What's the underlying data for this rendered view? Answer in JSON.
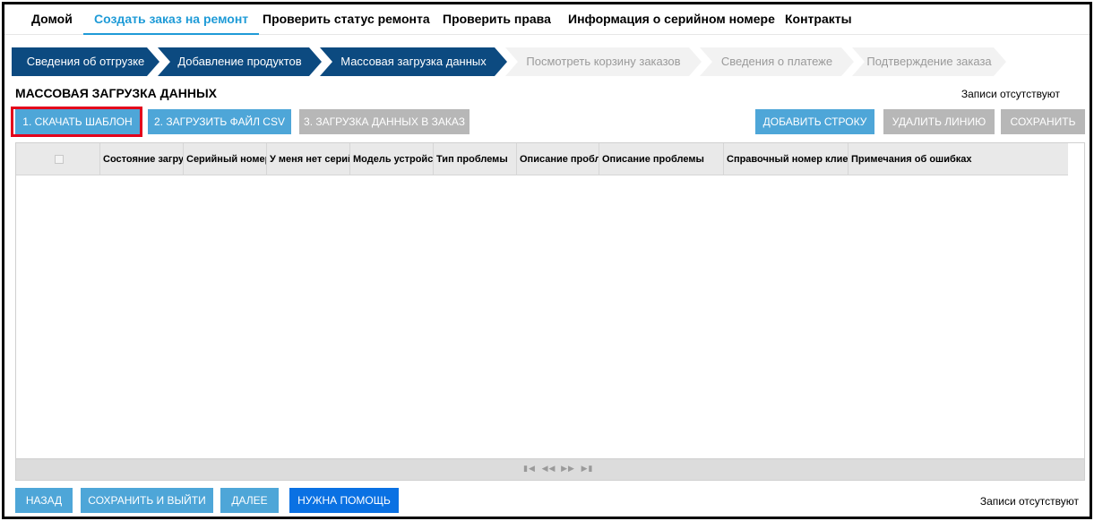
{
  "topnav": {
    "items": [
      {
        "label": "Домой",
        "active": false
      },
      {
        "label": "Создать заказ на ремонт",
        "active": true
      },
      {
        "label": "Проверить статус ремонта",
        "active": false
      },
      {
        "label": "Проверить права",
        "active": false
      },
      {
        "label": "Информация о серийном номере",
        "active": false
      },
      {
        "label": "Контракты",
        "active": false
      }
    ]
  },
  "steps": [
    {
      "label": "Сведения об отгрузке",
      "state": "done"
    },
    {
      "label": "Добавление продуктов",
      "state": "done"
    },
    {
      "label": "Массовая загрузка данных",
      "state": "done"
    },
    {
      "label": "Посмотреть корзину заказов",
      "state": "todo"
    },
    {
      "label": "Сведения о платеже",
      "state": "todo"
    },
    {
      "label": "Подтверждение заказа",
      "state": "todo"
    }
  ],
  "page": {
    "title": "МАССОВАЯ ЗАГРУЗКА ДАННЫХ",
    "records_top": "Записи отсутствуют",
    "records_bottom": "Записи отсутствуют"
  },
  "toolbar": {
    "download_template": "1. Скачать шаблон",
    "upload_csv": "2. Загрузить файл CSV",
    "load_to_order": "3. Загрузка данных в заказ",
    "add_row": "Добавить строку",
    "delete_line": "Удалить линию",
    "save": "Сохранить"
  },
  "grid": {
    "columns": [
      "Состояние загрузки",
      "Серийный номер",
      "У меня нет серийного номера",
      "Модель устройства",
      "Тип проблемы",
      "Описание проблемы",
      "Описание проблемы",
      "Справочный номер клиента",
      "Примечания об ошибках"
    ],
    "pager_icons": [
      "first-page-icon",
      "prev-page-icon",
      "next-page-icon",
      "last-page-icon"
    ]
  },
  "bottom": {
    "back": "Назад",
    "save_exit": "Сохранить и выйти",
    "next": "Далее",
    "help": "Нужна помощь"
  },
  "colors": {
    "nav_active": "#1f9bd7",
    "step_done": "#0c4a80",
    "button_blue": "#4ea6d8",
    "button_gray": "#b7b7b7",
    "button_help": "#0a71e3",
    "highlight": "#e3001b"
  }
}
